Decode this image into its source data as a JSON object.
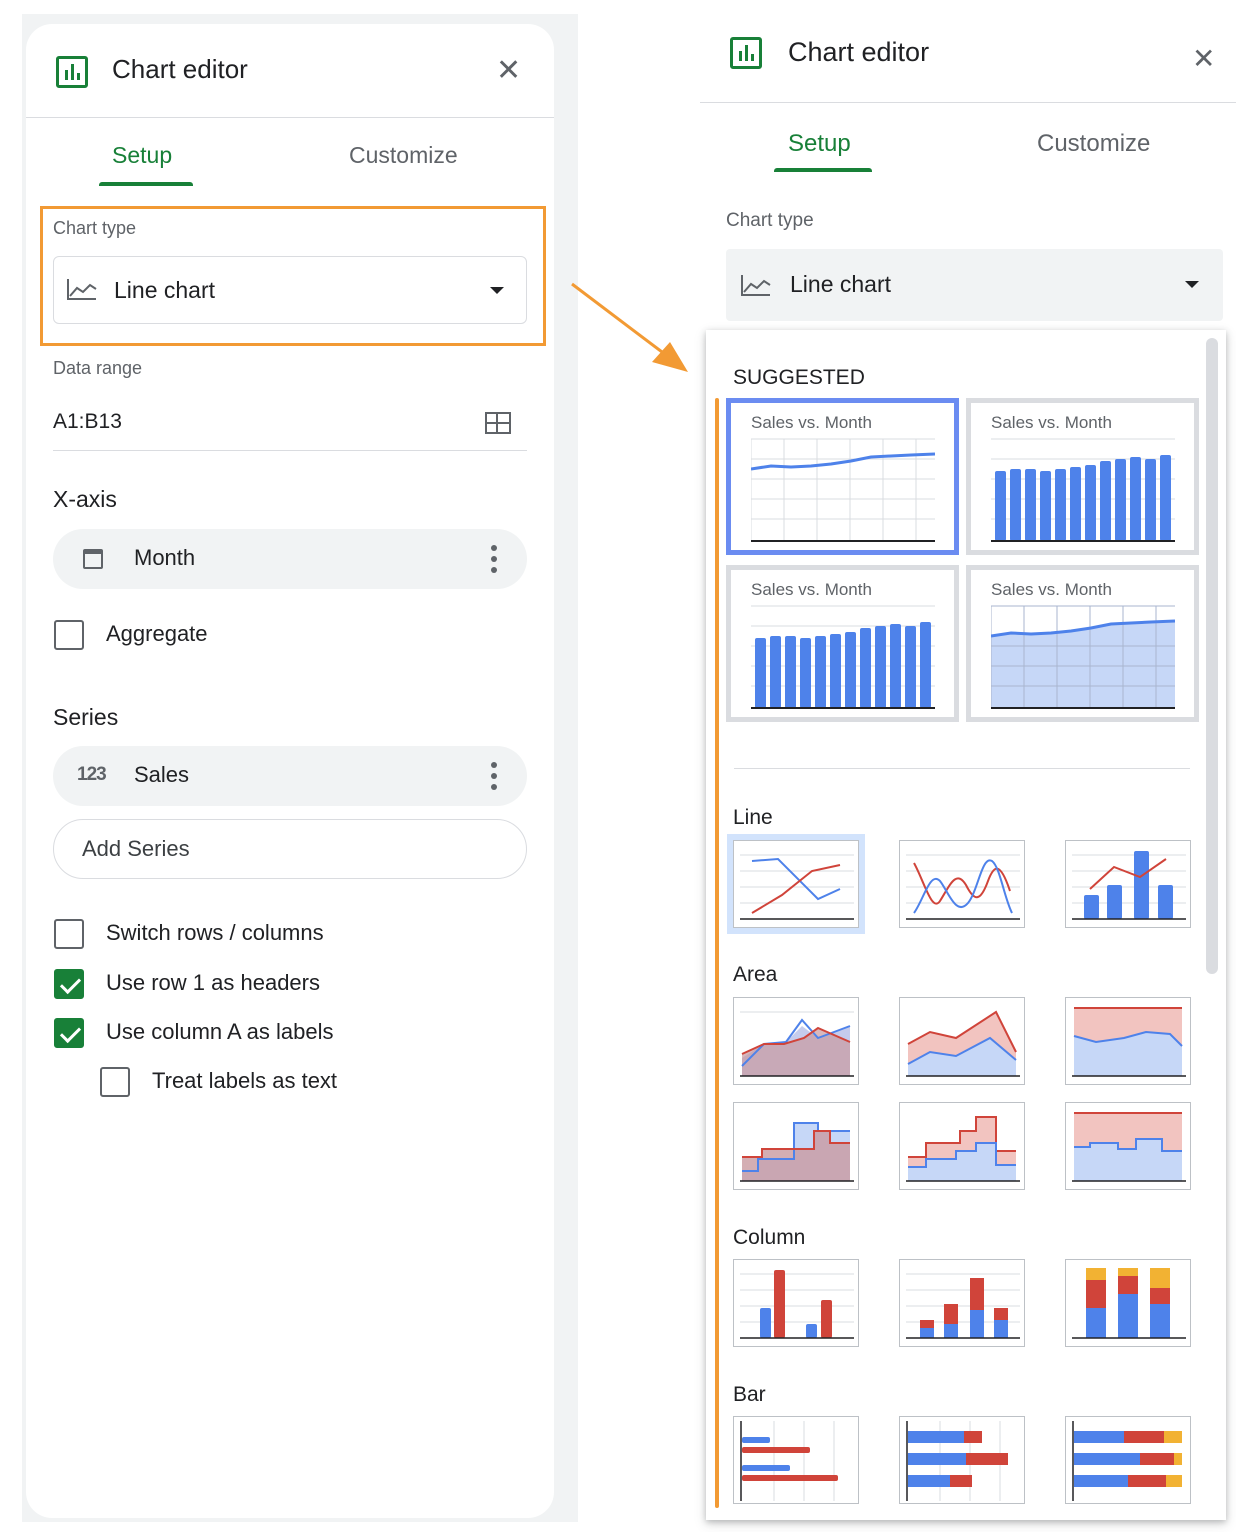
{
  "left": {
    "title": "Chart editor",
    "tabs": [
      "Setup",
      "Customize"
    ],
    "chart_type_label": "Chart type",
    "chart_type_value": "Line chart",
    "data_range_label": "Data range",
    "data_range_value": "A1:B13",
    "xaxis_title": "X-axis",
    "xaxis_chip": "Month",
    "aggregate_label": "Aggregate",
    "series_title": "Series",
    "series_icon_text": "123",
    "series_chip": "Sales",
    "add_series": "Add Series",
    "options": [
      {
        "label": "Switch rows / columns",
        "checked": false
      },
      {
        "label": "Use row 1 as headers",
        "checked": true
      },
      {
        "label": "Use column A as labels",
        "checked": true
      },
      {
        "label": "Treat labels as text",
        "checked": false
      }
    ]
  },
  "right": {
    "title": "Chart editor",
    "tabs": [
      "Setup",
      "Customize"
    ],
    "chart_type_label": "Chart type",
    "chart_type_value": "Line chart",
    "suggested_heading": "SUGGESTED",
    "suggested_card_title": "Sales vs. Month",
    "sections": [
      "Line",
      "Area",
      "Column",
      "Bar"
    ]
  },
  "colors": {
    "green": "#188038",
    "orange_highlight": "#f29a34",
    "blue": "#4e82ea",
    "red": "#d0443a",
    "yellow": "#f2b233",
    "selected_border": "#6b8cf1"
  },
  "icons": [
    "chart-editor-logo-icon",
    "close-icon",
    "line-chart-icon",
    "dropdown-caret-icon",
    "grid-select-icon",
    "calendar-icon",
    "more-vert-icon",
    "checkbox-icon"
  ]
}
